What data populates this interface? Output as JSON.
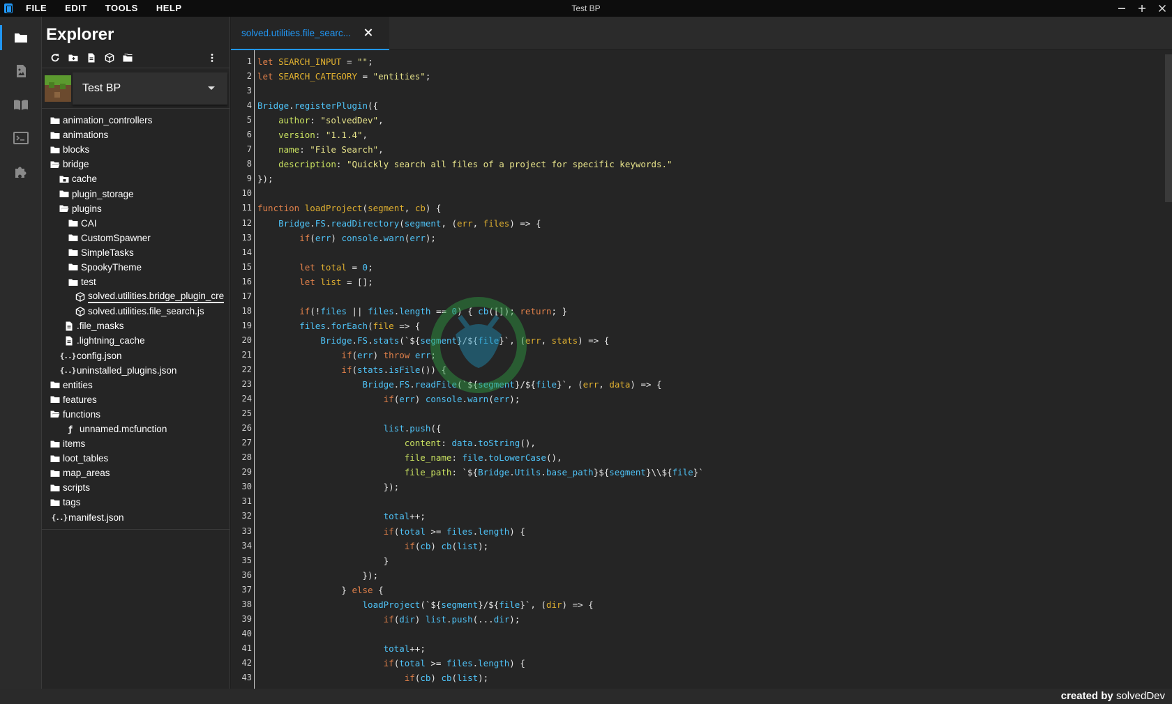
{
  "menu": {
    "items": [
      "FILE",
      "EDIT",
      "TOOLS",
      "HELP"
    ],
    "window_title": "Test BP"
  },
  "activity_bar": {
    "icons": [
      "folder-icon",
      "image-icon",
      "book-icon",
      "terminal-icon",
      "puzzle-icon"
    ]
  },
  "explorer": {
    "title": "Explorer",
    "toolbar_icons": [
      "refresh-icon",
      "new-folder-icon",
      "new-file-icon",
      "package-icon",
      "folders-icon",
      "more-vert-icon"
    ],
    "project_name": "Test BP",
    "tree": [
      {
        "label": "animation_controllers",
        "kind": "folder",
        "depth": 0
      },
      {
        "label": "animations",
        "kind": "folder",
        "depth": 0
      },
      {
        "label": "blocks",
        "kind": "folder",
        "depth": 0
      },
      {
        "label": "bridge",
        "kind": "folder-open",
        "depth": 0
      },
      {
        "label": "cache",
        "kind": "folder-lock",
        "depth": 1
      },
      {
        "label": "plugin_storage",
        "kind": "folder",
        "depth": 1
      },
      {
        "label": "plugins",
        "kind": "folder-open",
        "depth": 1
      },
      {
        "label": "CAI",
        "kind": "folder",
        "depth": 2
      },
      {
        "label": "CustomSpawner",
        "kind": "folder",
        "depth": 2
      },
      {
        "label": "SimpleTasks",
        "kind": "folder",
        "depth": 2
      },
      {
        "label": "SpookyTheme",
        "kind": "folder",
        "depth": 2
      },
      {
        "label": "test",
        "kind": "folder",
        "depth": 2
      },
      {
        "label": "solved.utilities.bridge_plugin_cre",
        "kind": "js",
        "depth": 3,
        "selected": true
      },
      {
        "label": "solved.utilities.file_search.js",
        "kind": "js",
        "depth": 3
      },
      {
        "label": ".file_masks",
        "kind": "file",
        "depth": 2
      },
      {
        "label": ".lightning_cache",
        "kind": "file",
        "depth": 2
      },
      {
        "label": "config.json",
        "kind": "json",
        "depth": 2
      },
      {
        "label": "uninstalled_plugins.json",
        "kind": "json",
        "depth": 2
      },
      {
        "label": "entities",
        "kind": "folder",
        "depth": 0
      },
      {
        "label": "features",
        "kind": "folder",
        "depth": 0
      },
      {
        "label": "functions",
        "kind": "folder-open",
        "depth": 0
      },
      {
        "label": "unnamed.mcfunction",
        "kind": "func",
        "depth": 2
      },
      {
        "label": "items",
        "kind": "folder",
        "depth": 0
      },
      {
        "label": "loot_tables",
        "kind": "folder",
        "depth": 0
      },
      {
        "label": "map_areas",
        "kind": "folder",
        "depth": 0
      },
      {
        "label": "scripts",
        "kind": "folder",
        "depth": 0
      },
      {
        "label": "tags",
        "kind": "folder",
        "depth": 0
      },
      {
        "label": "manifest.json",
        "kind": "json",
        "depth": 1
      }
    ]
  },
  "editor": {
    "tab_label": "solved.utilities.file_searc...",
    "lines": [
      [
        [
          "kw",
          "let "
        ],
        [
          "var",
          "SEARCH_INPUT"
        ],
        [
          "pl",
          " = "
        ],
        [
          "str",
          "\"\""
        ],
        [
          "pl",
          ";"
        ]
      ],
      [
        [
          "kw",
          "let "
        ],
        [
          "var",
          "SEARCH_CATEGORY"
        ],
        [
          "pl",
          " = "
        ],
        [
          "str",
          "\"entities\""
        ],
        [
          "pl",
          ";"
        ]
      ],
      [],
      [
        [
          "fn",
          "Bridge"
        ],
        [
          "pl",
          "."
        ],
        [
          "fn",
          "registerPlugin"
        ],
        [
          "pl",
          "({"
        ]
      ],
      [
        [
          "pl",
          "    "
        ],
        [
          "prop",
          "author"
        ],
        [
          "pl",
          ": "
        ],
        [
          "str",
          "\"solvedDev\""
        ],
        [
          "pl",
          ","
        ]
      ],
      [
        [
          "pl",
          "    "
        ],
        [
          "prop",
          "version"
        ],
        [
          "pl",
          ": "
        ],
        [
          "str",
          "\"1.1.4\""
        ],
        [
          "pl",
          ","
        ]
      ],
      [
        [
          "pl",
          "    "
        ],
        [
          "prop",
          "name"
        ],
        [
          "pl",
          ": "
        ],
        [
          "str",
          "\"File Search\""
        ],
        [
          "pl",
          ","
        ]
      ],
      [
        [
          "pl",
          "    "
        ],
        [
          "prop",
          "description"
        ],
        [
          "pl",
          ": "
        ],
        [
          "str",
          "\"Quickly search all files of a project for specific keywords.\""
        ]
      ],
      [
        [
          "pl",
          "});"
        ]
      ],
      [],
      [
        [
          "kw",
          "function "
        ],
        [
          "var",
          "loadProject"
        ],
        [
          "pl",
          "("
        ],
        [
          "var",
          "segment"
        ],
        [
          "pl",
          ", "
        ],
        [
          "var",
          "cb"
        ],
        [
          "pl",
          ") {"
        ]
      ],
      [
        [
          "pl",
          "    "
        ],
        [
          "fn",
          "Bridge"
        ],
        [
          "pl",
          "."
        ],
        [
          "fn",
          "FS"
        ],
        [
          "pl",
          "."
        ],
        [
          "fn",
          "readDirectory"
        ],
        [
          "pl",
          "("
        ],
        [
          "fn",
          "segment"
        ],
        [
          "pl",
          ", ("
        ],
        [
          "var",
          "err"
        ],
        [
          "pl",
          ", "
        ],
        [
          "var",
          "files"
        ],
        [
          "pl",
          ") => {"
        ]
      ],
      [
        [
          "pl",
          "        "
        ],
        [
          "kw",
          "if"
        ],
        [
          "pl",
          "("
        ],
        [
          "fn",
          "err"
        ],
        [
          "pl",
          ") "
        ],
        [
          "fn",
          "console"
        ],
        [
          "pl",
          "."
        ],
        [
          "fn",
          "warn"
        ],
        [
          "pl",
          "("
        ],
        [
          "fn",
          "err"
        ],
        [
          "pl",
          ");"
        ]
      ],
      [],
      [
        [
          "pl",
          "        "
        ],
        [
          "kw",
          "let "
        ],
        [
          "var",
          "total"
        ],
        [
          "pl",
          " = "
        ],
        [
          "num",
          "0"
        ],
        [
          "pl",
          ";"
        ]
      ],
      [
        [
          "pl",
          "        "
        ],
        [
          "kw",
          "let "
        ],
        [
          "var",
          "list"
        ],
        [
          "pl",
          " = [];"
        ]
      ],
      [],
      [
        [
          "pl",
          "        "
        ],
        [
          "kw",
          "if"
        ],
        [
          "pl",
          "(!"
        ],
        [
          "fn",
          "files"
        ],
        [
          "pl",
          " || "
        ],
        [
          "fn",
          "files"
        ],
        [
          "pl",
          "."
        ],
        [
          "fn",
          "length"
        ],
        [
          "pl",
          " == "
        ],
        [
          "num",
          "0"
        ],
        [
          "pl",
          ") { "
        ],
        [
          "fn",
          "cb"
        ],
        [
          "pl",
          "([]); "
        ],
        [
          "kw",
          "return"
        ],
        [
          "pl",
          "; }"
        ]
      ],
      [
        [
          "pl",
          "        "
        ],
        [
          "fn",
          "files"
        ],
        [
          "pl",
          "."
        ],
        [
          "fn",
          "forEach"
        ],
        [
          "pl",
          "("
        ],
        [
          "var",
          "file"
        ],
        [
          "pl",
          " => {"
        ]
      ],
      [
        [
          "pl",
          "            "
        ],
        [
          "fn",
          "Bridge"
        ],
        [
          "pl",
          "."
        ],
        [
          "fn",
          "FS"
        ],
        [
          "pl",
          "."
        ],
        [
          "fn",
          "stats"
        ],
        [
          "pl",
          "(`${"
        ],
        [
          "fn",
          "segment"
        ],
        [
          "pl",
          "}/${"
        ],
        [
          "fn",
          "file"
        ],
        [
          "pl",
          "}`, ("
        ],
        [
          "var",
          "err"
        ],
        [
          "pl",
          ", "
        ],
        [
          "var",
          "stats"
        ],
        [
          "pl",
          ") => {"
        ]
      ],
      [
        [
          "pl",
          "                "
        ],
        [
          "kw",
          "if"
        ],
        [
          "pl",
          "("
        ],
        [
          "fn",
          "err"
        ],
        [
          "pl",
          ") "
        ],
        [
          "kw",
          "throw "
        ],
        [
          "fn",
          "err"
        ],
        [
          "pl",
          ";"
        ]
      ],
      [
        [
          "pl",
          "                "
        ],
        [
          "kw",
          "if"
        ],
        [
          "pl",
          "("
        ],
        [
          "fn",
          "stats"
        ],
        [
          "pl",
          "."
        ],
        [
          "fn",
          "isFile"
        ],
        [
          "pl",
          "()) {"
        ]
      ],
      [
        [
          "pl",
          "                    "
        ],
        [
          "fn",
          "Bridge"
        ],
        [
          "pl",
          "."
        ],
        [
          "fn",
          "FS"
        ],
        [
          "pl",
          "."
        ],
        [
          "fn",
          "readFile"
        ],
        [
          "pl",
          "(`${"
        ],
        [
          "fn",
          "segment"
        ],
        [
          "pl",
          "}/${"
        ],
        [
          "fn",
          "file"
        ],
        [
          "pl",
          "}`, ("
        ],
        [
          "var",
          "err"
        ],
        [
          "pl",
          ", "
        ],
        [
          "var",
          "data"
        ],
        [
          "pl",
          ") => {"
        ]
      ],
      [
        [
          "pl",
          "                        "
        ],
        [
          "kw",
          "if"
        ],
        [
          "pl",
          "("
        ],
        [
          "fn",
          "err"
        ],
        [
          "pl",
          ") "
        ],
        [
          "fn",
          "console"
        ],
        [
          "pl",
          "."
        ],
        [
          "fn",
          "warn"
        ],
        [
          "pl",
          "("
        ],
        [
          "fn",
          "err"
        ],
        [
          "pl",
          ");"
        ]
      ],
      [],
      [
        [
          "pl",
          "                        "
        ],
        [
          "fn",
          "list"
        ],
        [
          "pl",
          "."
        ],
        [
          "fn",
          "push"
        ],
        [
          "pl",
          "({"
        ]
      ],
      [
        [
          "pl",
          "                            "
        ],
        [
          "prop",
          "content"
        ],
        [
          "pl",
          ": "
        ],
        [
          "fn",
          "data"
        ],
        [
          "pl",
          "."
        ],
        [
          "fn",
          "toString"
        ],
        [
          "pl",
          "(),"
        ]
      ],
      [
        [
          "pl",
          "                            "
        ],
        [
          "prop",
          "file_name"
        ],
        [
          "pl",
          ": "
        ],
        [
          "fn",
          "file"
        ],
        [
          "pl",
          "."
        ],
        [
          "fn",
          "toLowerCase"
        ],
        [
          "pl",
          "(),"
        ]
      ],
      [
        [
          "pl",
          "                            "
        ],
        [
          "prop",
          "file_path"
        ],
        [
          "pl",
          ": `${"
        ],
        [
          "fn",
          "Bridge"
        ],
        [
          "pl",
          "."
        ],
        [
          "fn",
          "Utils"
        ],
        [
          "pl",
          "."
        ],
        [
          "fn",
          "base_path"
        ],
        [
          "pl",
          "}${"
        ],
        [
          "fn",
          "segment"
        ],
        [
          "pl",
          "}\\\\${"
        ],
        [
          "fn",
          "file"
        ],
        [
          "pl",
          "}`"
        ]
      ],
      [
        [
          "pl",
          "                        });"
        ]
      ],
      [],
      [
        [
          "pl",
          "                        "
        ],
        [
          "fn",
          "total"
        ],
        [
          "pl",
          "++;"
        ]
      ],
      [
        [
          "pl",
          "                        "
        ],
        [
          "kw",
          "if"
        ],
        [
          "pl",
          "("
        ],
        [
          "fn",
          "total"
        ],
        [
          "pl",
          " >= "
        ],
        [
          "fn",
          "files"
        ],
        [
          "pl",
          "."
        ],
        [
          "fn",
          "length"
        ],
        [
          "pl",
          ") {"
        ]
      ],
      [
        [
          "pl",
          "                            "
        ],
        [
          "kw",
          "if"
        ],
        [
          "pl",
          "("
        ],
        [
          "fn",
          "cb"
        ],
        [
          "pl",
          ") "
        ],
        [
          "fn",
          "cb"
        ],
        [
          "pl",
          "("
        ],
        [
          "fn",
          "list"
        ],
        [
          "pl",
          ");"
        ]
      ],
      [
        [
          "pl",
          "                        }"
        ]
      ],
      [
        [
          "pl",
          "                    });"
        ]
      ],
      [
        [
          "pl",
          "                } "
        ],
        [
          "kw",
          "else"
        ],
        [
          "pl",
          " {"
        ]
      ],
      [
        [
          "pl",
          "                    "
        ],
        [
          "fn",
          "loadProject"
        ],
        [
          "pl",
          "(`${"
        ],
        [
          "fn",
          "segment"
        ],
        [
          "pl",
          "}/${"
        ],
        [
          "fn",
          "file"
        ],
        [
          "pl",
          "}`, ("
        ],
        [
          "var",
          "dir"
        ],
        [
          "pl",
          ") => {"
        ]
      ],
      [
        [
          "pl",
          "                        "
        ],
        [
          "kw",
          "if"
        ],
        [
          "pl",
          "("
        ],
        [
          "fn",
          "dir"
        ],
        [
          "pl",
          ") "
        ],
        [
          "fn",
          "list"
        ],
        [
          "pl",
          "."
        ],
        [
          "fn",
          "push"
        ],
        [
          "pl",
          "(..."
        ],
        [
          "fn",
          "dir"
        ],
        [
          "pl",
          ");"
        ]
      ],
      [],
      [
        [
          "pl",
          "                        "
        ],
        [
          "fn",
          "total"
        ],
        [
          "pl",
          "++;"
        ]
      ],
      [
        [
          "pl",
          "                        "
        ],
        [
          "kw",
          "if"
        ],
        [
          "pl",
          "("
        ],
        [
          "fn",
          "total"
        ],
        [
          "pl",
          " >= "
        ],
        [
          "fn",
          "files"
        ],
        [
          "pl",
          "."
        ],
        [
          "fn",
          "length"
        ],
        [
          "pl",
          ") {"
        ]
      ],
      [
        [
          "pl",
          "                            "
        ],
        [
          "kw",
          "if"
        ],
        [
          "pl",
          "("
        ],
        [
          "fn",
          "cb"
        ],
        [
          "pl",
          ") "
        ],
        [
          "fn",
          "cb"
        ],
        [
          "pl",
          "("
        ],
        [
          "fn",
          "list"
        ],
        [
          "pl",
          ");"
        ]
      ]
    ]
  },
  "status": {
    "credit_prefix": "created by",
    "credit_name": "solvedDev"
  },
  "colors": {
    "accent": "#2196f3",
    "keyword": "#e0804a",
    "variable": "#e0b030",
    "string": "#e6e28a",
    "identifier": "#4fc3f7",
    "property": "#c8e060"
  }
}
